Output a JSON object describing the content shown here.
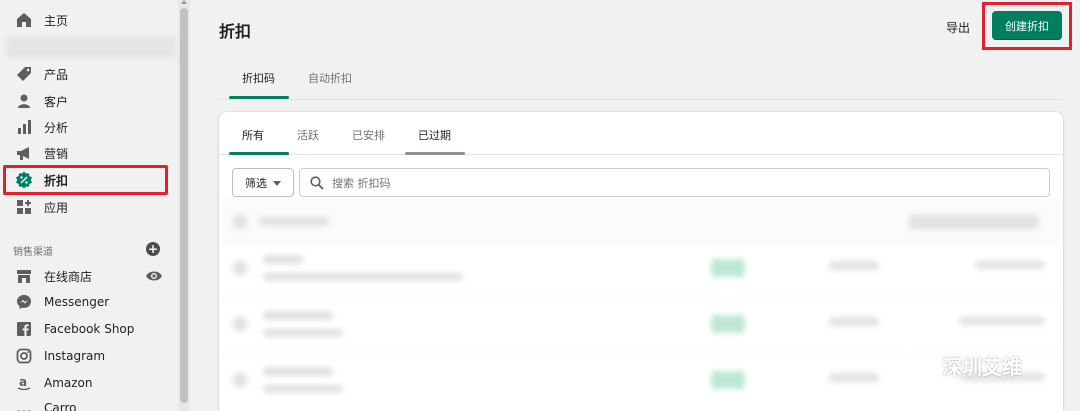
{
  "sidebar": {
    "items": [
      {
        "label": "主页",
        "icon": "home-icon"
      },
      {
        "label": "产品",
        "icon": "tag-icon"
      },
      {
        "label": "客户",
        "icon": "person-icon"
      },
      {
        "label": "分析",
        "icon": "bar-chart-icon"
      },
      {
        "label": "营销",
        "icon": "megaphone-icon"
      },
      {
        "label": "折扣",
        "icon": "discount-icon"
      },
      {
        "label": "应用",
        "icon": "apps-icon"
      }
    ],
    "section_label": "销售渠道",
    "add_symbol": "+",
    "channels": [
      {
        "label": "在线商店",
        "icon": "store-icon"
      },
      {
        "label": "Messenger",
        "icon": "messenger-icon"
      },
      {
        "label": "Facebook Shop",
        "icon": "facebook-icon"
      },
      {
        "label": "Instagram",
        "icon": "instagram-icon"
      },
      {
        "label": "Amazon",
        "icon": "amazon-icon"
      },
      {
        "label": "Carro",
        "icon": "carro-icon"
      }
    ]
  },
  "header": {
    "title": "折扣",
    "export_label": "导出",
    "create_label": "创建折扣"
  },
  "tabs": [
    {
      "label": "折扣码",
      "selected": true
    },
    {
      "label": "自动折扣",
      "selected": false
    }
  ],
  "card": {
    "tabs": [
      {
        "label": "所有",
        "selected": true
      },
      {
        "label": "活跃",
        "selected": false
      },
      {
        "label": "已安排",
        "selected": false
      },
      {
        "label": "已过期",
        "selected": false
      }
    ],
    "filter_label": "筛选",
    "search_placeholder": "搜索 折扣码"
  },
  "watermark": {
    "text": "深圳艾维"
  },
  "colors": {
    "accent": "#008060",
    "primary_button": "#007f5f",
    "highlight": "#e5202e"
  }
}
